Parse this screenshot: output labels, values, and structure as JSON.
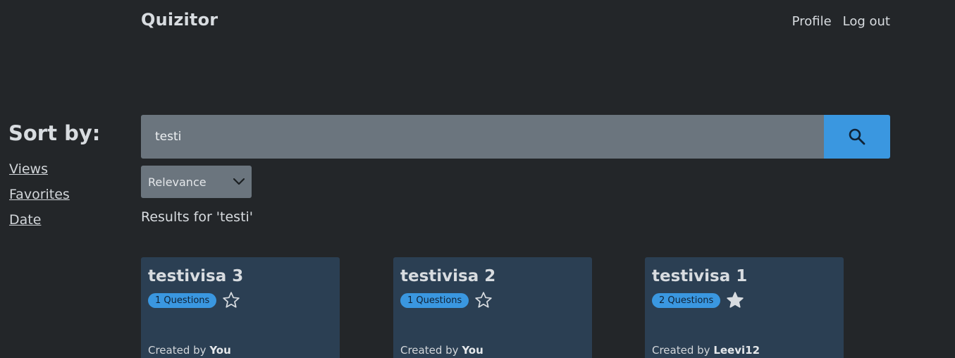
{
  "header": {
    "brand": "Quizitor",
    "nav": [
      {
        "label": "Profile"
      },
      {
        "label": "Log out"
      }
    ]
  },
  "sidebar": {
    "title": "Sort by:",
    "links": [
      {
        "label": "Views"
      },
      {
        "label": "Favorites"
      },
      {
        "label": "Date"
      }
    ]
  },
  "search": {
    "value": "testi",
    "button_icon": "search-icon"
  },
  "sort_select": {
    "selected": "Relevance",
    "icon": "chevron-down-icon"
  },
  "results": {
    "label": "Results for 'testi'",
    "cards": [
      {
        "title": "testivisa 3",
        "badge": "1 Questions",
        "favorited": false,
        "created_prefix": "Created by",
        "creator": "You"
      },
      {
        "title": "testivisa 2",
        "badge": "1 Questions",
        "favorited": false,
        "created_prefix": "Created by",
        "creator": "You"
      },
      {
        "title": "testivisa 1",
        "badge": "2 Questions",
        "favorited": true,
        "created_prefix": "Created by",
        "creator": "Leevi12"
      }
    ]
  },
  "colors": {
    "background": "#232629",
    "accent": "#3a97e0",
    "card": "#2b3f53",
    "input": "#6b757e"
  }
}
